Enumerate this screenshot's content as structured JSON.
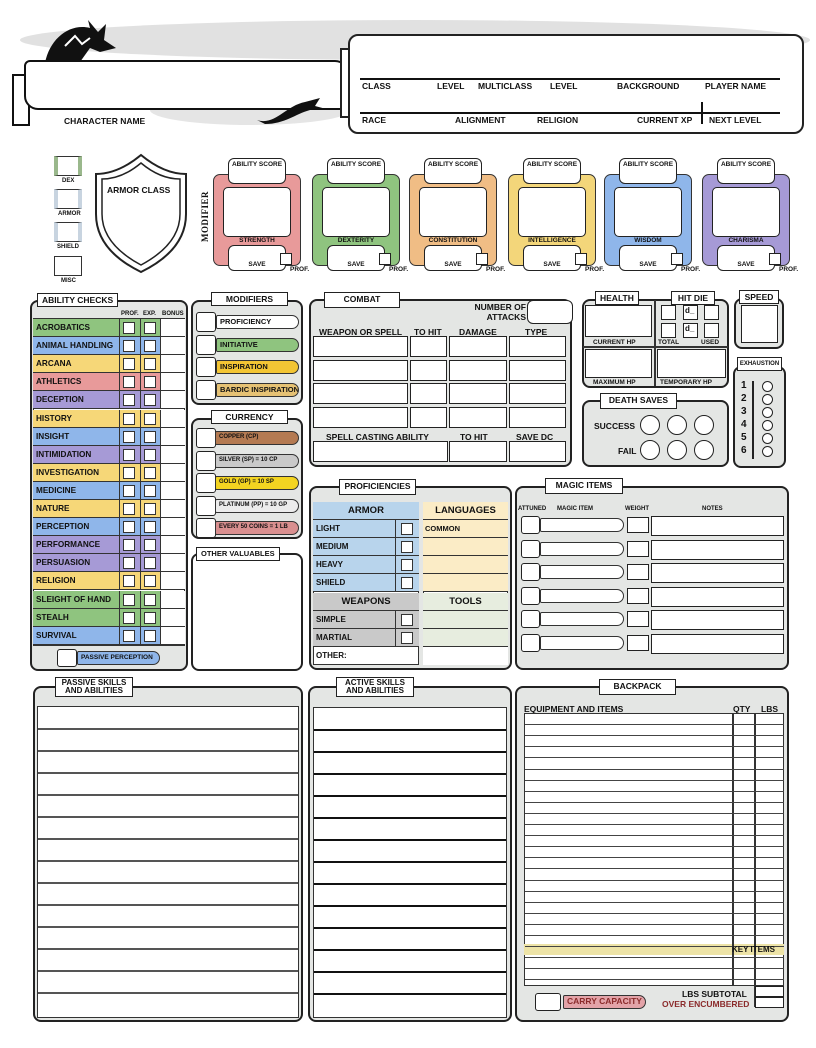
{
  "header": {
    "character_name_label": "CHARACTER NAME",
    "row1": [
      "CLASS",
      "LEVEL",
      "MULTICLASS",
      "LEVEL",
      "BACKGROUND",
      "PLAYER NAME"
    ],
    "row2": [
      "RACE",
      "ALIGNMENT",
      "RELIGION",
      "CURRENT XP",
      "NEXT LEVEL"
    ]
  },
  "armor": {
    "title": "ARMOR CLASS",
    "components": [
      "DEX",
      "ARMOR",
      "SHIELD",
      "MISC"
    ]
  },
  "abilities": {
    "modifier_label": "MODIFIER",
    "score_label": "ABILITY SCORE",
    "save_label": "SAVE",
    "prof_label": "PROF.",
    "items": [
      {
        "name": "STRENGTH",
        "color": "#e89a9a"
      },
      {
        "name": "DEXTERITY",
        "color": "#8fc47f"
      },
      {
        "name": "CONSTITUTION",
        "color": "#f0bd85"
      },
      {
        "name": "INTELLIGENCE",
        "color": "#f3d67a"
      },
      {
        "name": "WISDOM",
        "color": "#8fb6ea"
      },
      {
        "name": "CHARISMA",
        "color": "#a69ad6"
      }
    ]
  },
  "ability_checks": {
    "title": "ABILITY CHECKS",
    "headers": [
      "PROF.",
      "EXP.",
      "BONUS"
    ],
    "skills": [
      {
        "name": "ACROBATICS",
        "color": "#8fc47f"
      },
      {
        "name": "ANIMAL HANDLING",
        "color": "#8fb6ea"
      },
      {
        "name": "ARCANA",
        "color": "#f6d778"
      },
      {
        "name": "ATHLETICS",
        "color": "#e89a9a"
      },
      {
        "name": "DECEPTION",
        "color": "#a69ad6"
      },
      {
        "name": "HISTORY",
        "color": "#f6d778"
      },
      {
        "name": "INSIGHT",
        "color": "#8fb6ea"
      },
      {
        "name": "INTIMIDATION",
        "color": "#a69ad6"
      },
      {
        "name": "INVESTIGATION",
        "color": "#f6d778"
      },
      {
        "name": "MEDICINE",
        "color": "#8fb6ea"
      },
      {
        "name": "NATURE",
        "color": "#f6d778"
      },
      {
        "name": "PERCEPTION",
        "color": "#8fb6ea"
      },
      {
        "name": "PERFORMANCE",
        "color": "#a69ad6"
      },
      {
        "name": "PERSUASION",
        "color": "#a69ad6"
      },
      {
        "name": "RELIGION",
        "color": "#f6d778"
      },
      {
        "name": "SLEIGHT OF HAND",
        "color": "#8fc47f"
      },
      {
        "name": "STEALH",
        "color": "#8fc47f"
      },
      {
        "name": "SURVIVAL",
        "color": "#8fb6ea"
      }
    ],
    "passive_perception": "PASSIVE PERCEPTION"
  },
  "modifiers": {
    "title": "MODIFIERS",
    "items": [
      {
        "label": "PROFICIENCY",
        "color": "#ffffff"
      },
      {
        "label": "INITIATIVE",
        "color": "#8fc47f"
      },
      {
        "label": "INSPIRATION",
        "color": "#f3c534"
      },
      {
        "label": "BARDIC INSPIRATION",
        "color": "#e6c274"
      }
    ]
  },
  "currency": {
    "title": "CURRENCY",
    "items": [
      {
        "label": "COPPER (CP)",
        "color": "#b47a52"
      },
      {
        "label": "SILVER (SP) = 10 CP",
        "color": "#c9c9c9"
      },
      {
        "label": "GOLD (GP) = 10 SP",
        "color": "#f3d421"
      },
      {
        "label": "PLATINUM (PP) = 10 GP",
        "color": "#ececec"
      },
      {
        "label": "EVERY 50 COINS = 1 LB",
        "color": "#d98f8f"
      }
    ]
  },
  "other_valuables": {
    "title": "OTHER VALUABLES"
  },
  "combat": {
    "title": "COMBAT",
    "attacks_label": "NUMBER OF ATTACKS",
    "columns": [
      "WEAPON OR SPELL",
      "TO HIT",
      "DAMAGE",
      "TYPE"
    ],
    "spell_columns": [
      "SPELL CASTING ABILITY",
      "TO HIT",
      "SAVE DC"
    ]
  },
  "health": {
    "title": "HEALTH",
    "current_hp": "CURRENT HP",
    "maximum_hp": "MAXIMUM HP",
    "temporary_hp": "TEMPORARY HP"
  },
  "hit_die": {
    "title": "HIT DIE",
    "die_placeholder": "d_",
    "total_label": "TOTAL",
    "used_label": "USED"
  },
  "speed": {
    "title": "SPEED"
  },
  "exhaustion": {
    "title": "EXHAUSTION",
    "levels": [
      "1",
      "2",
      "3",
      "4",
      "5",
      "6"
    ]
  },
  "death_saves": {
    "title": "DEATH SAVES",
    "success": "SUCCESS",
    "fail": "FAIL"
  },
  "proficiencies": {
    "title": "PROFICIENCIES",
    "armor_title": "ARMOR",
    "armor": [
      "LIGHT",
      "MEDIUM",
      "HEAVY",
      "SHIELD"
    ],
    "weapons_title": "WEAPONS",
    "weapons": [
      "SIMPLE",
      "MARTIAL"
    ],
    "other": "OTHER:",
    "languages_title": "LANGUAGES",
    "languages": [
      "COMMON"
    ],
    "tools_title": "TOOLS"
  },
  "magic_items": {
    "title": "MAGIC ITEMS",
    "headers": [
      "ATTUNED",
      "MAGIC ITEM",
      "WEIGHT",
      "NOTES"
    ]
  },
  "passive_skills": {
    "title_line1": "PASSIVE SKILLS",
    "title_line2": "AND ABILITIES"
  },
  "active_skills": {
    "title_line1": "ACTIVE SKILLS",
    "title_line2": "AND ABILITIES"
  },
  "backpack": {
    "title": "BACKPACK",
    "headers": [
      "EQUIPMENT AND ITEMS",
      "QTY",
      "LBS"
    ],
    "key_items": "KEY ITEMS",
    "lbs_subtotal": "LBS SUBTOTAL",
    "over_encumbered": "OVER ENCUMBERED",
    "carry_capacity": "CARRY CAPACITY"
  }
}
